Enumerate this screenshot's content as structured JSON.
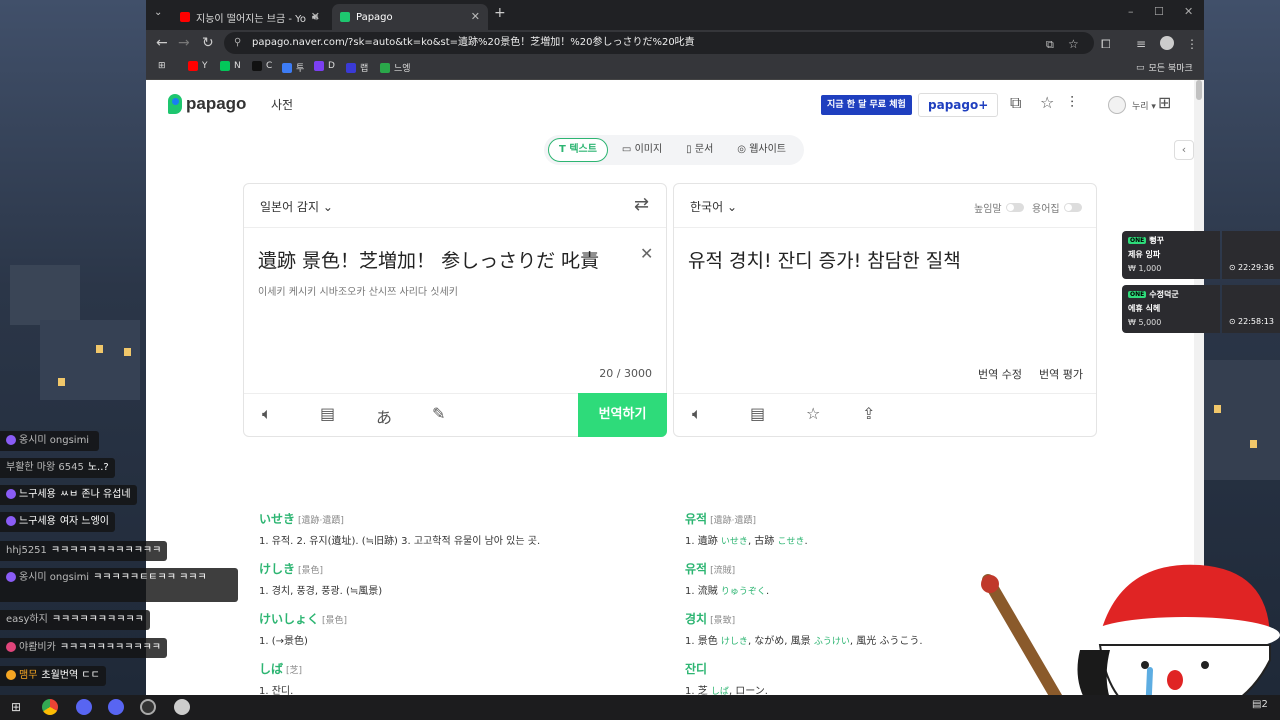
{
  "browser": {
    "tabs": [
      {
        "label": "지능이 떨어지는 브금 - Yo",
        "favicon": "youtube-icon",
        "audio": true
      },
      {
        "label": "Papago",
        "favicon": "papago-icon",
        "active": true
      }
    ],
    "url": "papago.naver.com/?sk=auto&tk=ko&st=遺跡%20景色！芝増加！%20参しっさりだ%20叱責",
    "bookmarks": [
      {
        "label": "Y",
        "color": "#ff0000"
      },
      {
        "label": "N",
        "color": "#03c75a"
      },
      {
        "label": "C",
        "color": "#222222"
      },
      {
        "label": "투",
        "color": "#3d7cf5"
      },
      {
        "label": "D",
        "color": "#7b3ff2"
      },
      {
        "label": "랩",
        "color": "#3a3ad6"
      },
      {
        "label": "느엥",
        "color": "#2aa84a"
      }
    ],
    "all_bookmarks": "모든 북마크"
  },
  "header": {
    "logo_text": "papago",
    "dict_link": "사전",
    "trial_button": "지금 한 달 무료 체험",
    "papago_plus": "papago+",
    "login": "누리 ▾"
  },
  "mode_tabs": [
    {
      "icon": "T",
      "label": "텍스트",
      "active": true
    },
    {
      "icon": "▭",
      "label": "이미지",
      "active": false
    },
    {
      "icon": "▯",
      "label": "문서",
      "active": false
    },
    {
      "icon": "◎",
      "label": "웹사이트",
      "active": false
    }
  ],
  "source": {
    "language": "일본어 감지",
    "text": "遺跡 景色！芝増加！ 参しっさりだ 叱責",
    "reading": "이세키 케시키 시바조오카 산시쯔 사리다 싯세키",
    "counter": "20 / 3000",
    "translate_button": "번역하기"
  },
  "target": {
    "language": "한국어",
    "honorific_toggle": "높임말",
    "glossary_toggle": "용어집",
    "text": "유적 경치! 잔디 증가! 참담한 질책",
    "edit_link": "번역 수정",
    "rate_link": "번역 평가"
  },
  "dictionary": {
    "left": [
      {
        "head": "いせき",
        "hanja": "[遺跡·遺蹟]",
        "desc": "1. 유적.   2. 유지(遺址). (≒旧跡)   3. 고고학적 유물이 남아 있는 곳."
      },
      {
        "head": "けしき",
        "hanja": "[景色]",
        "desc": "1. 경치, 풍경, 풍광. (≒風景)"
      },
      {
        "head": "けいしょく",
        "hanja": "[景色]",
        "desc": "1. (→景色)"
      },
      {
        "head": "しば",
        "hanja": "[芝]",
        "desc": "1. 잔디."
      }
    ],
    "right": [
      {
        "head": "유적",
        "hanja": "[遺跡·遺蹟]",
        "desc": "1. 遺跡",
        "kana1": "いせき",
        "desc2": ", 古跡",
        "kana2": "こせき",
        "desc3": "."
      },
      {
        "head": "유적",
        "hanja": "[流賊]",
        "desc": "1. 流賊",
        "kana1": "りゅうぞく",
        "desc2": ".",
        "kana2": "",
        "desc3": ""
      },
      {
        "head": "경치",
        "hanja": "[景致]",
        "desc": "1. 景色",
        "kana1": "けしき",
        "desc2": ", ながめ, 風景",
        "kana2": "ふうけい",
        "desc3": ", 風光 ふうこう."
      },
      {
        "head": "잔디",
        "hanja": "",
        "desc": "1. 芝",
        "kana1": "しば",
        "desc2": ", ローン.",
        "kana2": "",
        "desc3": ""
      }
    ]
  },
  "donations": [
    {
      "name": "뻥꾸",
      "message": "제유 잉파",
      "amount": "₩ 1,000",
      "time": "⊙ 22:29:36"
    },
    {
      "name": "수정덕군",
      "message": "에휴 식헤",
      "amount": "₩ 5,000",
      "time": "⊙ 22:58:13"
    }
  ],
  "chat": [
    {
      "name": "옹시미 ongsimi",
      "message": "",
      "color": "#8a5cf6"
    },
    {
      "name": "부활한 마왕 6545",
      "message": "노..?",
      "color": ""
    },
    {
      "name": "느구세용",
      "message": "ㅆㅂ 존나 유섭네",
      "color": "#8a5cf6"
    },
    {
      "name": "느구세용",
      "message": "여자 느엥이",
      "color": "#8a5cf6"
    },
    {
      "name": "hhj5251",
      "message": "ㅋㅋㅋㅋㅋㅋㅋㅋㅋㅋㅋㅋ",
      "color": ""
    },
    {
      "name": "옹시미 ongsimi",
      "message": "ㅋㅋㅋㅋㅋㅌㅌㅋㅋ ㅋㅋㅋ",
      "color": "#8a5cf6"
    },
    {
      "name": "easy하지",
      "message": "ㅋㅋㅋㅋㅋㅋㅋㅋㅋㅋ",
      "color": ""
    },
    {
      "name": "야뢈비카",
      "message": "ㅋㅋㅋㅋㅋㅋㅋㅋㅋㅋㅋ",
      "color": "#e0457b"
    },
    {
      "name": "맴무",
      "message": "초월번역 ㄷㄷ",
      "color": "#f5a623"
    }
  ],
  "taskbar": {
    "notification_count": "2"
  }
}
